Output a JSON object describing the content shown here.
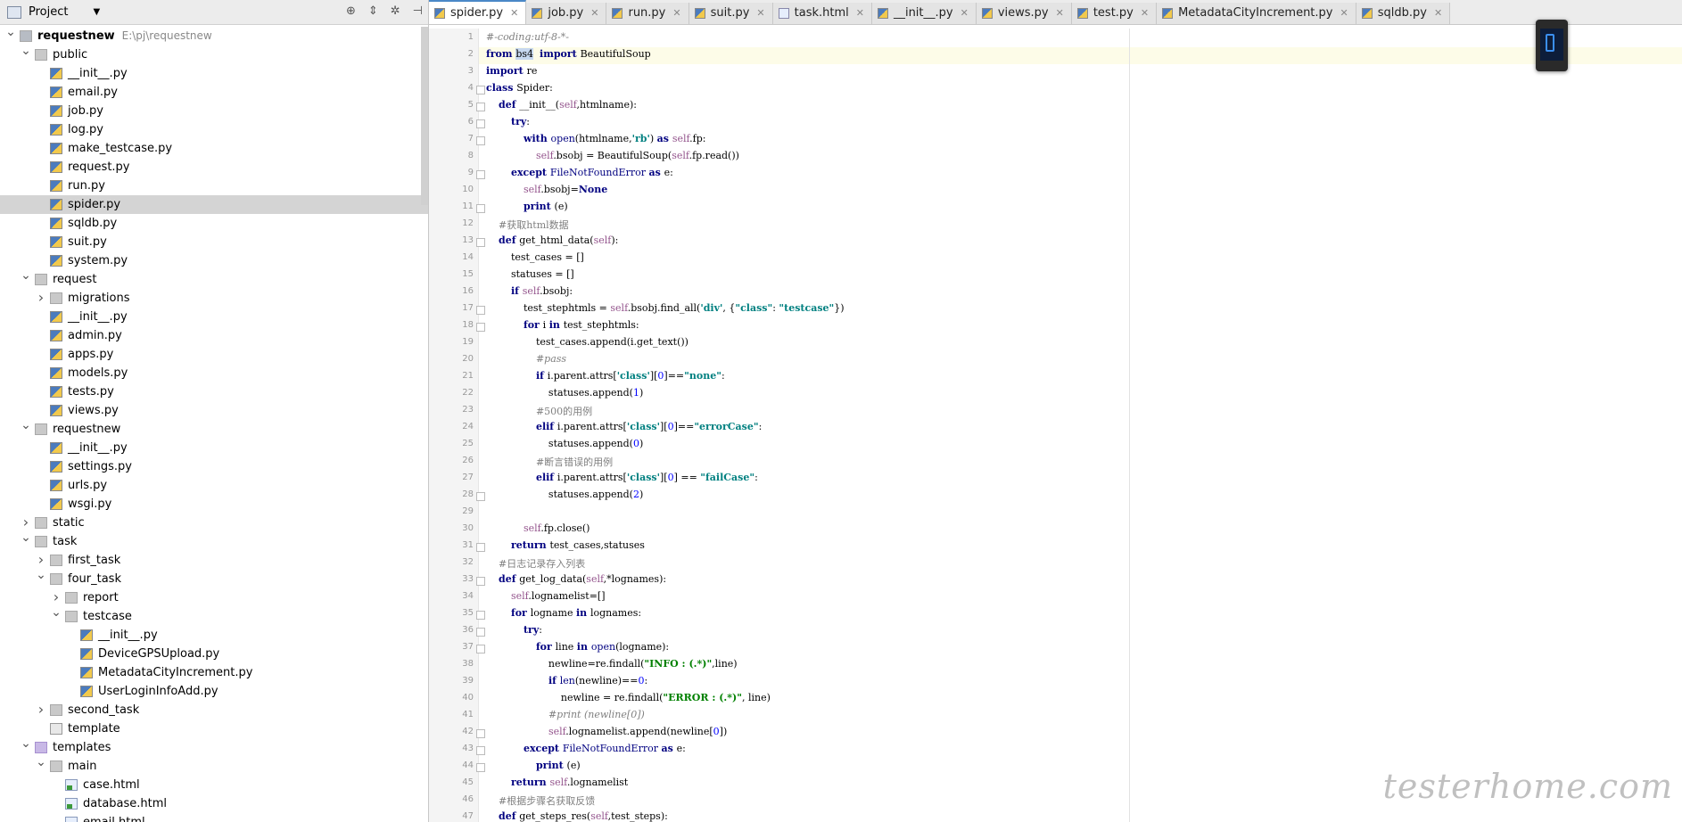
{
  "project_panel": {
    "title": "Project",
    "tree": [
      {
        "label": "requestnew",
        "sub": "E:\\pj\\requestnew",
        "depth": 0,
        "type": "proj",
        "open": true,
        "bold": true
      },
      {
        "label": "public",
        "depth": 1,
        "type": "folder",
        "open": true
      },
      {
        "label": "__init__.py",
        "depth": 2,
        "type": "py"
      },
      {
        "label": "email.py",
        "depth": 2,
        "type": "py"
      },
      {
        "label": "job.py",
        "depth": 2,
        "type": "py"
      },
      {
        "label": "log.py",
        "depth": 2,
        "type": "py"
      },
      {
        "label": "make_testcase.py",
        "depth": 2,
        "type": "py"
      },
      {
        "label": "request.py",
        "depth": 2,
        "type": "py"
      },
      {
        "label": "run.py",
        "depth": 2,
        "type": "py"
      },
      {
        "label": "spider.py",
        "depth": 2,
        "type": "py",
        "selected": true
      },
      {
        "label": "sqldb.py",
        "depth": 2,
        "type": "py"
      },
      {
        "label": "suit.py",
        "depth": 2,
        "type": "py"
      },
      {
        "label": "system.py",
        "depth": 2,
        "type": "py"
      },
      {
        "label": "request",
        "depth": 1,
        "type": "folder",
        "open": true
      },
      {
        "label": "migrations",
        "depth": 2,
        "type": "folder",
        "open": false
      },
      {
        "label": "__init__.py",
        "depth": 2,
        "type": "py"
      },
      {
        "label": "admin.py",
        "depth": 2,
        "type": "py"
      },
      {
        "label": "apps.py",
        "depth": 2,
        "type": "py"
      },
      {
        "label": "models.py",
        "depth": 2,
        "type": "py"
      },
      {
        "label": "tests.py",
        "depth": 2,
        "type": "py"
      },
      {
        "label": "views.py",
        "depth": 2,
        "type": "py"
      },
      {
        "label": "requestnew",
        "depth": 1,
        "type": "folder",
        "open": true
      },
      {
        "label": "__init__.py",
        "depth": 2,
        "type": "py"
      },
      {
        "label": "settings.py",
        "depth": 2,
        "type": "py"
      },
      {
        "label": "urls.py",
        "depth": 2,
        "type": "py"
      },
      {
        "label": "wsgi.py",
        "depth": 2,
        "type": "py"
      },
      {
        "label": "static",
        "depth": 1,
        "type": "folder",
        "open": false
      },
      {
        "label": "task",
        "depth": 1,
        "type": "folder",
        "open": true
      },
      {
        "label": "first_task",
        "depth": 2,
        "type": "folder",
        "open": false
      },
      {
        "label": "four_task",
        "depth": 2,
        "type": "folder",
        "open": true
      },
      {
        "label": "report",
        "depth": 3,
        "type": "folder",
        "open": false
      },
      {
        "label": "testcase",
        "depth": 3,
        "type": "folder",
        "open": true
      },
      {
        "label": "__init__.py",
        "depth": 4,
        "type": "py"
      },
      {
        "label": "DeviceGPSUpload.py",
        "depth": 4,
        "type": "py"
      },
      {
        "label": "MetadataCityIncrement.py",
        "depth": 4,
        "type": "py"
      },
      {
        "label": "UserLoginInfoAdd.py",
        "depth": 4,
        "type": "py"
      },
      {
        "label": "second_task",
        "depth": 2,
        "type": "folder",
        "open": false
      },
      {
        "label": "template",
        "depth": 2,
        "type": "tplfile"
      },
      {
        "label": "templates",
        "depth": 1,
        "type": "tpl",
        "open": true
      },
      {
        "label": "main",
        "depth": 2,
        "type": "folder",
        "open": true
      },
      {
        "label": "case.html",
        "depth": 3,
        "type": "html"
      },
      {
        "label": "database.html",
        "depth": 3,
        "type": "html"
      },
      {
        "label": "email.html",
        "depth": 3,
        "type": "html"
      }
    ]
  },
  "tabs": [
    {
      "label": "spider.py",
      "active": true,
      "icon": "py"
    },
    {
      "label": "job.py",
      "icon": "py"
    },
    {
      "label": "run.py",
      "icon": "py"
    },
    {
      "label": "suit.py",
      "icon": "py"
    },
    {
      "label": "task.html",
      "icon": "html"
    },
    {
      "label": "__init__.py",
      "icon": "py"
    },
    {
      "label": "views.py",
      "icon": "py"
    },
    {
      "label": "test.py",
      "icon": "py"
    },
    {
      "label": "MetadataCityIncrement.py",
      "icon": "py"
    },
    {
      "label": "sqldb.py",
      "icon": "py"
    }
  ],
  "code_lines": [
    [
      [
        "c",
        "#-coding:utf-8-*-"
      ]
    ],
    [
      [
        "k",
        "from "
      ],
      [
        "hl",
        "bs4"
      ],
      [
        "",
        "  "
      ],
      [
        "k",
        "import "
      ],
      [
        "",
        "BeautifulSoup"
      ]
    ],
    [
      [
        "k",
        "import "
      ],
      [
        "",
        "re"
      ]
    ],
    [
      [
        "k",
        "class "
      ],
      [
        "",
        "Spider:"
      ]
    ],
    [
      [
        "",
        "    "
      ],
      [
        "k",
        "def "
      ],
      [
        "",
        "__init__("
      ],
      [
        "self",
        "self"
      ],
      [
        "",
        ",htmlname):"
      ]
    ],
    [
      [
        "",
        "        "
      ],
      [
        "k",
        "try"
      ],
      [
        "",
        ":"
      ]
    ],
    [
      [
        "",
        "            "
      ],
      [
        "k",
        "with "
      ],
      [
        "b",
        "open"
      ],
      [
        "",
        "(htmlname,"
      ],
      [
        "s",
        "'rb'"
      ],
      [
        "",
        ") "
      ],
      [
        "k",
        "as "
      ],
      [
        "self",
        "self"
      ],
      [
        "",
        ".fp:"
      ]
    ],
    [
      [
        "",
        "                "
      ],
      [
        "self",
        "self"
      ],
      [
        "",
        ".bsobj = BeautifulSoup("
      ],
      [
        "self",
        "self"
      ],
      [
        "",
        ".fp.read())"
      ]
    ],
    [
      [
        "",
        "        "
      ],
      [
        "k",
        "except "
      ],
      [
        "b",
        "FileNotFoundError "
      ],
      [
        "k",
        "as "
      ],
      [
        "",
        "e:"
      ]
    ],
    [
      [
        "",
        "            "
      ],
      [
        "self",
        "self"
      ],
      [
        "",
        ".bsobj="
      ],
      [
        "k",
        "None"
      ]
    ],
    [
      [
        "",
        "            "
      ],
      [
        "k",
        "print "
      ],
      [
        "",
        "(e)"
      ]
    ],
    [
      [
        "",
        "    "
      ],
      [
        "cn",
        "#获取html数据"
      ]
    ],
    [
      [
        "",
        "    "
      ],
      [
        "k",
        "def "
      ],
      [
        "",
        "get_html_data("
      ],
      [
        "self",
        "self"
      ],
      [
        "",
        "):"
      ]
    ],
    [
      [
        "",
        "        test_cases = []"
      ]
    ],
    [
      [
        "",
        "        statuses = []"
      ]
    ],
    [
      [
        "",
        "        "
      ],
      [
        "k",
        "if "
      ],
      [
        "self",
        "self"
      ],
      [
        "",
        ".bsobj:"
      ]
    ],
    [
      [
        "",
        "            test_stephtmls = "
      ],
      [
        "self",
        "self"
      ],
      [
        "",
        ".bsobj.find_all("
      ],
      [
        "s",
        "'div'"
      ],
      [
        "",
        ", {"
      ],
      [
        "s",
        "\"class\""
      ],
      [
        "",
        ": "
      ],
      [
        "s",
        "\"testcase\""
      ],
      [
        "",
        "})"
      ]
    ],
    [
      [
        "",
        "            "
      ],
      [
        "k",
        "for "
      ],
      [
        "",
        "i "
      ],
      [
        "k",
        "in "
      ],
      [
        "",
        "test_stephtmls:"
      ]
    ],
    [
      [
        "",
        "                test_cases.append(i.get_text())"
      ]
    ],
    [
      [
        "",
        "                "
      ],
      [
        "c",
        "#pass"
      ]
    ],
    [
      [
        "",
        "                "
      ],
      [
        "k",
        "if "
      ],
      [
        "",
        "i.parent.attrs["
      ],
      [
        "s",
        "'class'"
      ],
      [
        "",
        "]["
      ],
      [
        "n",
        "0"
      ],
      [
        "",
        "]=="
      ],
      [
        "s",
        "\"none\""
      ],
      [
        "",
        ":"
      ]
    ],
    [
      [
        "",
        "                    statuses.append("
      ],
      [
        "n",
        "1"
      ],
      [
        "",
        ")"
      ]
    ],
    [
      [
        "",
        "                "
      ],
      [
        "cn",
        "#500的用例"
      ]
    ],
    [
      [
        "",
        "                "
      ],
      [
        "k",
        "elif "
      ],
      [
        "",
        "i.parent.attrs["
      ],
      [
        "s",
        "'class'"
      ],
      [
        "",
        "]["
      ],
      [
        "n",
        "0"
      ],
      [
        "",
        "]=="
      ],
      [
        "s",
        "\"errorCase\""
      ],
      [
        "",
        ":"
      ]
    ],
    [
      [
        "",
        "                    statuses.append("
      ],
      [
        "n",
        "0"
      ],
      [
        "",
        ")"
      ]
    ],
    [
      [
        "",
        "                "
      ],
      [
        "cn",
        "#断言错误的用例"
      ]
    ],
    [
      [
        "",
        "                "
      ],
      [
        "k",
        "elif "
      ],
      [
        "",
        "i.parent.attrs["
      ],
      [
        "s",
        "'class'"
      ],
      [
        "",
        "]["
      ],
      [
        "n",
        "0"
      ],
      [
        "",
        "] == "
      ],
      [
        "s",
        "\"failCase\""
      ],
      [
        "",
        ":"
      ]
    ],
    [
      [
        "",
        "                    statuses.append("
      ],
      [
        "n",
        "2"
      ],
      [
        "",
        ")"
      ]
    ],
    [
      [
        "",
        ""
      ]
    ],
    [
      [
        "",
        "            "
      ],
      [
        "self",
        "self"
      ],
      [
        "",
        ".fp.close()"
      ]
    ],
    [
      [
        "",
        "        "
      ],
      [
        "k",
        "return "
      ],
      [
        "",
        "test_cases,statuses"
      ]
    ],
    [
      [
        "",
        "    "
      ],
      [
        "cn",
        "#日志记录存入列表"
      ]
    ],
    [
      [
        "",
        "    "
      ],
      [
        "k",
        "def "
      ],
      [
        "",
        "get_log_data("
      ],
      [
        "self",
        "self"
      ],
      [
        "",
        ",*lognames):"
      ]
    ],
    [
      [
        "",
        "        "
      ],
      [
        "self",
        "self"
      ],
      [
        "",
        ".lognamelist=[]"
      ]
    ],
    [
      [
        "",
        "        "
      ],
      [
        "k",
        "for "
      ],
      [
        "",
        "logname "
      ],
      [
        "k",
        "in "
      ],
      [
        "",
        "lognames:"
      ]
    ],
    [
      [
        "",
        "            "
      ],
      [
        "k",
        "try"
      ],
      [
        "",
        ":"
      ]
    ],
    [
      [
        "",
        "                "
      ],
      [
        "k",
        "for "
      ],
      [
        "",
        "line "
      ],
      [
        "k",
        "in "
      ],
      [
        "b",
        "open"
      ],
      [
        "",
        "(logname):"
      ]
    ],
    [
      [
        "",
        "                    newline=re.findall("
      ],
      [
        "sgreen",
        "\"INFO : (.*)\""
      ],
      [
        "",
        ",line)"
      ]
    ],
    [
      [
        "",
        "                    "
      ],
      [
        "k",
        "if "
      ],
      [
        "b",
        "len"
      ],
      [
        "",
        "(newline)=="
      ],
      [
        "n",
        "0"
      ],
      [
        "",
        ":"
      ]
    ],
    [
      [
        "",
        "                        newline = re.findall("
      ],
      [
        "sgreen",
        "\"ERROR : (.*)\""
      ],
      [
        "",
        ", line)"
      ]
    ],
    [
      [
        "",
        "                    "
      ],
      [
        "c",
        "#print (newline[0])"
      ]
    ],
    [
      [
        "",
        "                    "
      ],
      [
        "self",
        "self"
      ],
      [
        "",
        ".lognamelist.append(newline["
      ],
      [
        "n",
        "0"
      ],
      [
        "",
        "])"
      ]
    ],
    [
      [
        "",
        "            "
      ],
      [
        "k",
        "except "
      ],
      [
        "b",
        "FileNotFoundError "
      ],
      [
        "k",
        "as "
      ],
      [
        "",
        "e:"
      ]
    ],
    [
      [
        "",
        "                "
      ],
      [
        "k",
        "print "
      ],
      [
        "",
        "(e)"
      ]
    ],
    [
      [
        "",
        "        "
      ],
      [
        "k",
        "return "
      ],
      [
        "self",
        "self"
      ],
      [
        "",
        ".lognamelist"
      ]
    ],
    [
      [
        "",
        "    "
      ],
      [
        "cn",
        "#根据步骤名获取反馈"
      ]
    ],
    [
      [
        "",
        "    "
      ],
      [
        "k",
        "def "
      ],
      [
        "",
        "get_steps_res("
      ],
      [
        "self",
        "self"
      ],
      [
        "",
        ",test_steps):"
      ]
    ]
  ],
  "watermark": "testerhome.com"
}
